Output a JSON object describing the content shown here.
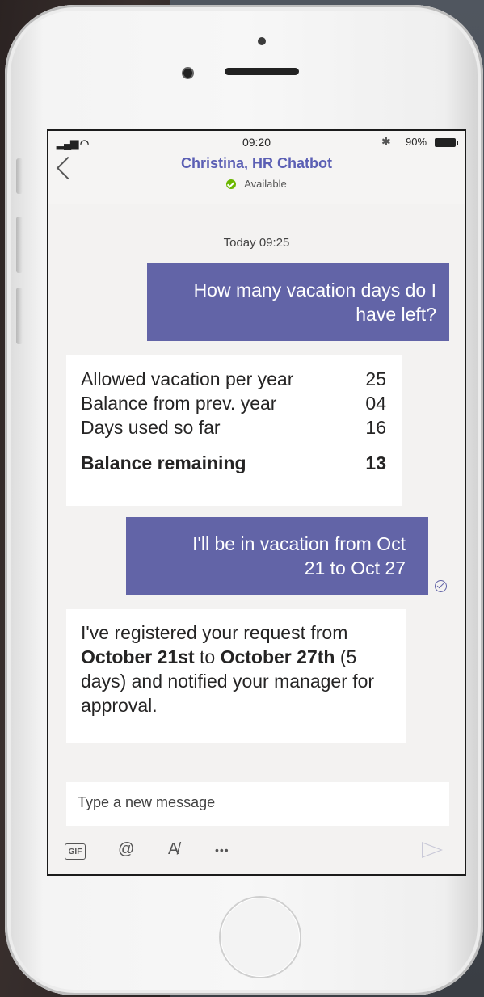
{
  "status_bar": {
    "signal": "▂▄▆ ◠",
    "time": "09:20",
    "bluetooth": "✱",
    "battery": "90%"
  },
  "header": {
    "title": "Christina, HR Chatbot",
    "presence": "Available"
  },
  "chat": {
    "date_separator": "Today 09:25",
    "messages": [
      {
        "from": "me",
        "text": "How many vacation days do I have left?"
      },
      {
        "from": "bot",
        "table": [
          {
            "label": "Allowed vacation per year",
            "value": "25"
          },
          {
            "label": "Balance from prev. year",
            "value": "04"
          },
          {
            "label": "Days used so far",
            "value": "16"
          },
          {
            "label": "Balance remaining",
            "value": "13"
          }
        ]
      },
      {
        "from": "me",
        "text": "I'll be in vacation from Oct 21 to Oct 27"
      },
      {
        "from": "bot",
        "parts": [
          "I've registered your request from ",
          "October 21st",
          " to ",
          "October 27th",
          " (5 days) and notified your manager for approval."
        ]
      }
    ]
  },
  "compose": {
    "placeholder": "Type a new message",
    "gif_label": "GIF",
    "at_label": "@",
    "format_label": "A̸",
    "more_label": "•••"
  },
  "colors": {
    "accent": "#6264a7",
    "title": "#5b5fb4",
    "presence": "#6bb700"
  }
}
